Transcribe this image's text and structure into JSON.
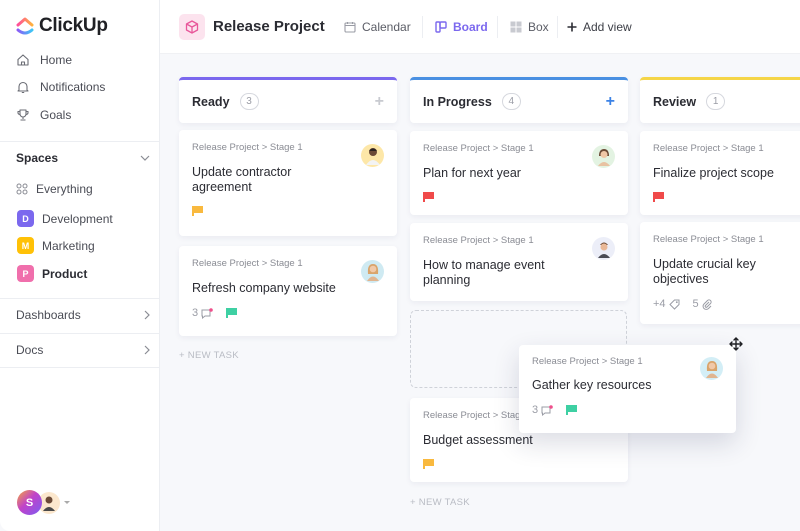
{
  "app": {
    "name": "ClickUp"
  },
  "sidebar": {
    "nav": [
      {
        "label": "Home",
        "icon": "home-icon"
      },
      {
        "label": "Notifications",
        "icon": "bell-icon"
      },
      {
        "label": "Goals",
        "icon": "trophy-icon"
      }
    ],
    "spaces_title": "Spaces",
    "everything_label": "Everything",
    "spaces": [
      {
        "label": "Development",
        "initial": "D",
        "color": "#7b68ee",
        "active": false
      },
      {
        "label": "Marketing",
        "initial": "M",
        "color": "#ffc107",
        "active": false
      },
      {
        "label": "Product",
        "initial": "P",
        "color": "#f06fac",
        "active": true
      }
    ],
    "dashboards_label": "Dashboards",
    "docs_label": "Docs",
    "user_initial": "S"
  },
  "header": {
    "project_title": "Release Project",
    "views": [
      {
        "label": "Calendar",
        "icon": "calendar-icon",
        "active": false
      },
      {
        "label": "Board",
        "icon": "board-icon",
        "active": true
      },
      {
        "label": "Box",
        "icon": "box-icon",
        "active": false
      }
    ],
    "add_view_label": "Add view"
  },
  "board": {
    "columns": [
      {
        "title": "Ready",
        "count": "3",
        "color": "#7b68ee",
        "add_color": "#c8cad0",
        "cards": [
          {
            "path": "Release Project > Stage 1",
            "title": "Update contractor agreement",
            "flag": "#f9b93e"
          },
          {
            "path": "Release Project > Stage 1",
            "title": "Refresh company website",
            "comments": "3",
            "flag": "#3ed0a3"
          }
        ],
        "new_task": "+ NEW TASK"
      },
      {
        "title": "In Progress",
        "count": "4",
        "color": "#4a90e2",
        "add_color": "#3b82e6",
        "cards": [
          {
            "path": "Release Project > Stage 1",
            "title": "Plan for next year",
            "flag": "#f04a4a"
          },
          {
            "path": "Release Project > Stage 1",
            "title": "How to manage event planning"
          },
          {
            "path": "Release Project > Stage 1",
            "title": "Budget assessment",
            "flag": "#f9b93e"
          }
        ],
        "new_task": "+ NEW TASK"
      },
      {
        "title": "Review",
        "count": "1",
        "color": "#f5d547",
        "cards": [
          {
            "path": "Release Project > Stage 1",
            "title": "Finalize project scope",
            "flag": "#f04a4a"
          },
          {
            "path": "Release Project > Stage 1",
            "title": "Update crucial key objectives",
            "tags": "+4",
            "attachments": "5"
          }
        ]
      }
    ],
    "dragging_card": {
      "path": "Release Project > Stage 1",
      "title": "Gather key resources",
      "comments": "3",
      "flag": "#3ed0a3"
    }
  }
}
